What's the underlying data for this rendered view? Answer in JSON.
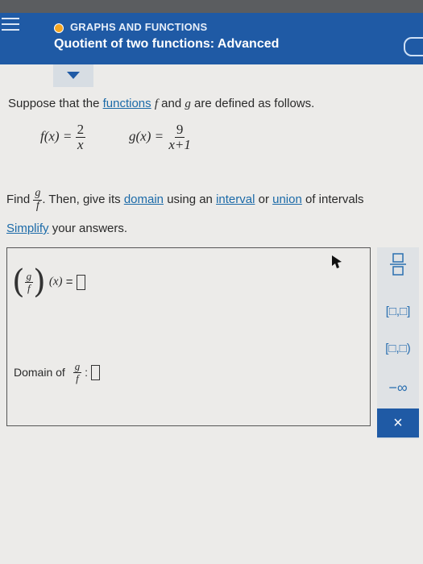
{
  "header": {
    "category": "GRAPHS AND FUNCTIONS",
    "title": "Quotient of two functions: Advanced"
  },
  "problem": {
    "intro_prefix": "Suppose that the",
    "intro_link": "functions",
    "intro_f": "f",
    "intro_and": "and",
    "intro_g": "g",
    "intro_suffix": "are defined as follows.",
    "f_lhs": "f(x) =",
    "f_num": "2",
    "f_den": "x",
    "g_lhs": "g(x) =",
    "g_num": "9",
    "g_den": "x+1",
    "find_prefix": "Find",
    "find_num": "g",
    "find_den": "f",
    "find_text": ". Then, give its",
    "domain_link": "domain",
    "using": "using an",
    "interval_link": "interval",
    "or": "or",
    "union_link": "union",
    "of_intervals": "of intervals",
    "simplify_link": "Simplify",
    "simplify_rest": "your answers."
  },
  "answer": {
    "quot_num": "g",
    "quot_den": "f",
    "of_x": "(x)",
    "equals": "=",
    "domain_label": "Domain of",
    "domain_num": "g",
    "domain_den": "f",
    "colon": ":"
  },
  "keypad": {
    "closed_interval": "[□,□]",
    "half_open_interval": "[□,□)",
    "neg_infinity": "−∞",
    "close": "×"
  }
}
